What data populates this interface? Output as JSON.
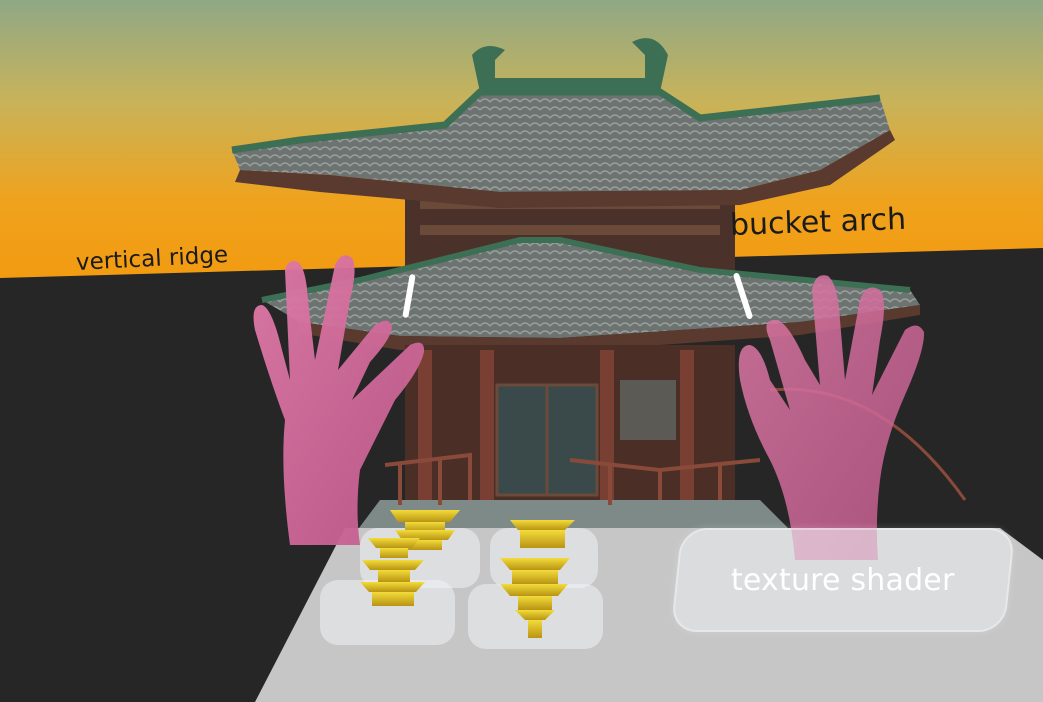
{
  "scene": {
    "labels": {
      "vertical_ridge": "vertical ridge",
      "bucket_arch": "bucket arch"
    },
    "panel": {
      "texture_shader_button": "texture shader",
      "model_slots": 4
    },
    "colors": {
      "sky_top": "#8fa886",
      "sky_horizon": "#f0a21c",
      "ground": "#262626",
      "roof_tiles": "#7c807e",
      "roof_ridge": "#3d6f55",
      "timber": "#5a3a2e",
      "hands": "#d46a9a",
      "gold_models": "#e2c51f",
      "panel": "#c8c8c8"
    },
    "icons": [
      "temple-model-icon",
      "pagoda-model-icon",
      "left-hand-icon",
      "right-hand-icon",
      "pointer-ray-icon"
    ]
  }
}
